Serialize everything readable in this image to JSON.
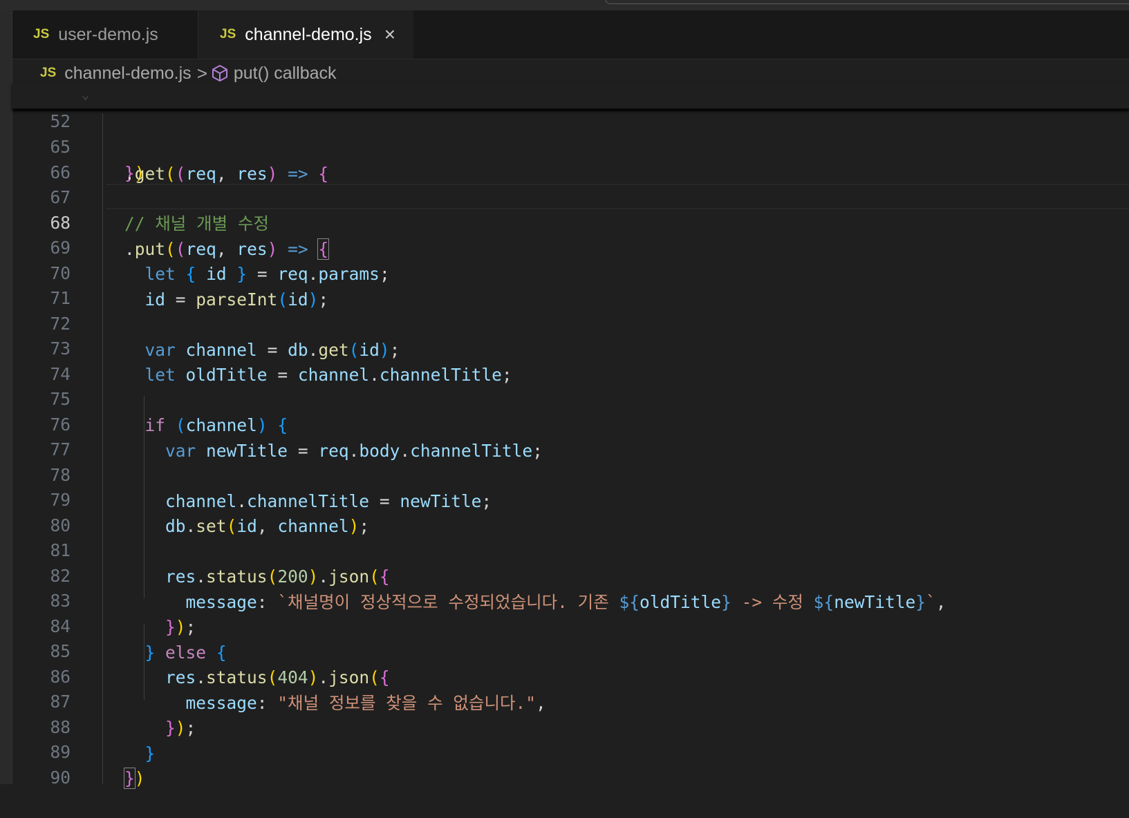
{
  "tabs": [
    {
      "icon": "JS",
      "label": "user-demo.js",
      "active": false
    },
    {
      "icon": "JS",
      "label": "channel-demo.js",
      "active": true,
      "close": "×"
    }
  ],
  "breadcrumb": {
    "file_icon": "JS",
    "file": "channel-demo.js",
    "separator": ">",
    "symbol_icon": "cube-icon",
    "symbol": "put() callback"
  },
  "editor": {
    "active_line": 68,
    "lines": [
      {
        "n": "52",
        "text": "  .get((req, res) => {"
      },
      {
        "n": "65",
        "text": "  })"
      },
      {
        "n": "66",
        "text": ""
      },
      {
        "n": "67",
        "text": "  // 채널 개별 수정"
      },
      {
        "n": "68",
        "text": "  .put((req, res) => {"
      },
      {
        "n": "69",
        "text": "    let { id } = req.params;"
      },
      {
        "n": "70",
        "text": "    id = parseInt(id);"
      },
      {
        "n": "71",
        "text": ""
      },
      {
        "n": "72",
        "text": "    var channel = db.get(id);"
      },
      {
        "n": "73",
        "text": "    let oldTitle = channel.channelTitle;"
      },
      {
        "n": "74",
        "text": ""
      },
      {
        "n": "75",
        "text": "    if (channel) {"
      },
      {
        "n": "76",
        "text": "      var newTitle = req.body.channelTitle;"
      },
      {
        "n": "77",
        "text": ""
      },
      {
        "n": "78",
        "text": "      channel.channelTitle = newTitle;"
      },
      {
        "n": "79",
        "text": "      db.set(id, channel);"
      },
      {
        "n": "80",
        "text": ""
      },
      {
        "n": "81",
        "text": "      res.status(200).json({"
      },
      {
        "n": "82",
        "text": "        message: `채널명이 정상적으로 수정되었습니다. 기존 ${oldTitle} -> 수정 ${newTitle}`,"
      },
      {
        "n": "83",
        "text": "      });"
      },
      {
        "n": "84",
        "text": "    } else {"
      },
      {
        "n": "85",
        "text": "      res.status(404).json({"
      },
      {
        "n": "86",
        "text": "        message: \"채널 정보를 찾을 수 없습니다.\","
      },
      {
        "n": "87",
        "text": "      });"
      },
      {
        "n": "88",
        "text": "    }"
      },
      {
        "n": "89",
        "text": "  })"
      },
      {
        "n": "90",
        "text": ""
      }
    ]
  },
  "colors": {
    "background": "#1f1f1f",
    "keyword": "#569cd6",
    "function": "#dcdcaa",
    "variable": "#9cdcfe",
    "string": "#ce9178",
    "number": "#b5cea8",
    "comment": "#6a9955",
    "js_icon": "#cbcb41"
  }
}
